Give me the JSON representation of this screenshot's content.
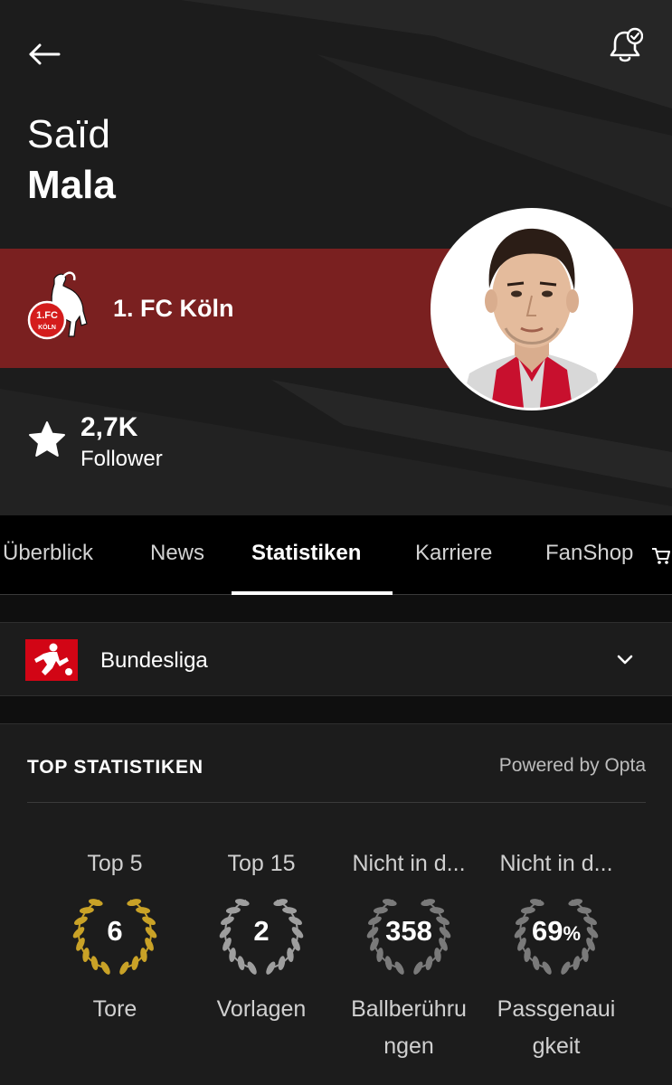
{
  "header": {
    "first_name": "Saïd",
    "last_name": "Mala"
  },
  "club": {
    "name": "1. FC Köln",
    "logo_text_top": "1.FC",
    "logo_text_bottom": "KÖLN",
    "band_color": "#7a2020"
  },
  "followers": {
    "count": "2,7K",
    "label": "Follower"
  },
  "tabs": [
    {
      "label": "Überblick",
      "active": false
    },
    {
      "label": "News",
      "active": false
    },
    {
      "label": "Statistiken",
      "active": true
    },
    {
      "label": "Karriere",
      "active": false
    },
    {
      "label": "FanShop",
      "active": false
    }
  ],
  "league": {
    "name": "Bundesliga",
    "logo_color": "#d20515"
  },
  "stats": {
    "title": "TOP STATISTIKEN",
    "powered_by": "Powered by Opta",
    "items": [
      {
        "rank": "Top 5",
        "value": "6",
        "unit": "",
        "label": "Tore",
        "wreath_color": "#c9a227"
      },
      {
        "rank": "Top 15",
        "value": "2",
        "unit": "",
        "label": "Vorlagen",
        "wreath_color": "#9e9e9e"
      },
      {
        "rank": "Nicht in d...",
        "value": "358",
        "unit": "",
        "label": "Ballberührungen",
        "wreath_color": "#7a7a7a"
      },
      {
        "rank": "Nicht in d...",
        "value": "69",
        "unit": "%",
        "label": "Passgenauigkeit",
        "wreath_color": "#7a7a7a"
      }
    ]
  },
  "icons": {
    "back": "arrow-left-icon",
    "bell": "bell-check-icon",
    "star": "star-icon",
    "cart": "cart-icon",
    "chevron": "chevron-down-icon"
  }
}
